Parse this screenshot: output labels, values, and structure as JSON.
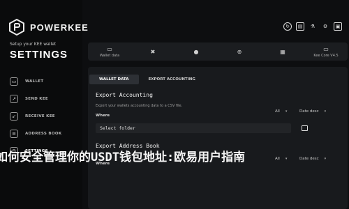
{
  "brand": {
    "name": "POWERKEE",
    "setup_text": "Setup your KEE wallet",
    "section_title": "SETTINGS"
  },
  "sidebar": {
    "items": [
      {
        "label": "WALLET",
        "icon": "wallet-icon"
      },
      {
        "label": "SEND KEE",
        "icon": "send-icon"
      },
      {
        "label": "RECEIVE KEE",
        "icon": "receive-icon"
      },
      {
        "label": "ADDRESS BOOK",
        "icon": "address-book-icon"
      },
      {
        "label": "SETTINGS",
        "icon": "gear-icon",
        "active": true
      }
    ]
  },
  "top_icons": [
    "refresh-icon",
    "print-icon",
    "flask-icon",
    "gear-icon",
    "lock-icon"
  ],
  "tabs": [
    {
      "label": "Wallet data",
      "icon": "wallet-icon"
    },
    {
      "label": "",
      "icon": "tools-icon"
    },
    {
      "label": "",
      "icon": "user-icon"
    },
    {
      "label": "",
      "icon": "network-icon"
    },
    {
      "label": "",
      "icon": "chip-icon"
    },
    {
      "label": "Kee Core V4.5",
      "icon": "computer-icon"
    }
  ],
  "subtabs": [
    "WALLET DATA",
    "EXPORT ACCOUNTING"
  ],
  "export_accounting": {
    "title": "Export Accounting",
    "desc": "Export your wallets accounting data to a CSV file.",
    "where": "Where",
    "filter_all": "All",
    "filter_sort": "Date desc",
    "input": "Select folder"
  },
  "export_address_book": {
    "title": "Export Address Book",
    "where": "Where",
    "filter_all": "All",
    "filter_sort": "Date desc"
  },
  "overlay_text": "如何安全管理你的USDT钱包地址:欧易用户指南"
}
